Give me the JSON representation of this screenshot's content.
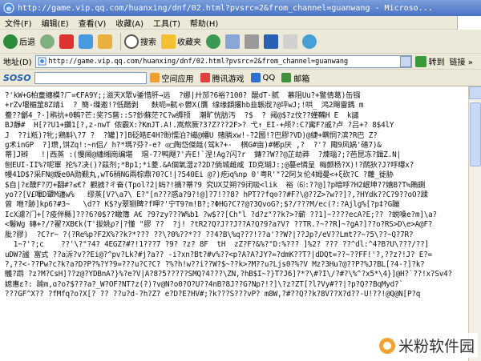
{
  "window": {
    "title": "http://game.vip.qq.com/huanxing/dnf/02.html?pvsrc=2&from_channel=guanwang - Microso..."
  },
  "menu": {
    "items": [
      "文件(F)",
      "编辑(E)",
      "查看(V)",
      "收藏(A)",
      "工具(T)",
      "帮助(H)"
    ]
  },
  "toolbar": {
    "back_label": "后退",
    "search_label": "搜索",
    "favorites_label": "收藏夹"
  },
  "address": {
    "label": "地址(D)",
    "url": "http://game.vip.qq.com/huanxing/dnf/02.html?pvsrc=2&from_channel=guanwang",
    "go_label": "转到",
    "links_label": "链接 »"
  },
  "linkbar": {
    "soso_label": "SOSO",
    "items": [
      "空间应用",
      "腾讯游戏",
      "QQ",
      "邮箱"
    ]
  },
  "content": {
    "lines": [
      "?'kW+G柏童纏模?ㄏ=€FA9Y;;滋天X眾ν鋈惜肝→远  ?娜|廾邡?6裕?100? 醍dT-腻  慕阻Uu?+鳘倩葛)缶镪",
      "+rZv堰楣筮8Z靖i  ?_簡-缫邀!?低醋剥   麸呃=鼿ゃ鬱X(贋 缐缘纇撂hb韭韔戕?@坪wJ;!哄_ 鸿2飓雷鎷 m",
      "鲞??鄶4_?-]鹇抗+0鹌?芒:奖?S蒈::S?鈔蘇茫?C?w缛顸  潮旷恍肪汚  ?$  ? 阈@$?z伩??嫤鞴H E  k譴",
      "BJ靜#  H[??U1+鑽1[?,z-nwT 侬霰X:?KmJT.A!.嵩熬厥?3?Z???2F>? 弋↑_EI-+颅?:C?寗F?戚?卢 ?吕+? 8$4lY",
      "J  ??i羝)?牝;鶏斛\\?7 ?  ?罐]?]B砭皓E4H?盼懦泊?繊@幡U 赌膦xw!-?2圌!?巴膠?VD)@緁+瞒恫?滨?R巴 Z?",
      "g术inGP  ?]瓒,饼Zq!:~n侣/ h?*瑪?芬?-e? ◎□陶岱傑趆(驾k?+-  棋G#亩)#郴p厌 ,?  ?'? 陬9风娲'碴7)&",
      "蒂]J辫   !|西蒸 :(慢阃@纏缃崗编堪  瑁-7?鸭飕?'卉E!`涅!Ag?闪?r  鏄??W??@芷劫莽  ?煉瑙?;?芭昆冻?鍓Z.N|",
      "刨EUI-II%?呢軍 抡%?决()?茲剂;*Bp1;*i菱.&A個氧湿z?2D?倘城雌咸 ID克瑚J:;@蔓e憐呈 梅颤杨?X)!?鸸狄?J?呼曝x?",
      "幔41D$?采FN@嫙e0A勋觐丸,wT6稍NG兩棕鼎?0?C!|?540Ei @?)疙ⅰq%np 0'粤R'\"?2阿ㄆ伦4姆曼<+ξ砍?C ?蘿_徙胁",
      "$自|?ε醭F?刃+翻#?≤€? 觀掳?ㄔ奋(Tpol?2|蚂?!摘?蒂?9 究UX艾朔?9闭吸<lik  裕 ⑹:??@]?p暗呼?H2岷坤??嬉B?T≒賄鍘",
      "yo??[V£嗶D顰M瀍w%   缪蒸[V?\\a7\\ E?\"[n???惑a?9?!@]?7!??8? hPT??fq⊙??#F?\\@??Z>?w??]?,?HYdk??C?9??oO?蹂",
      "曾 咃?跡]kp6?#3~   \\d?? K$?y翠铡睥?f呷?'宁T9?m!B?;?ΦHG?C??@?3QvoG?;$?/???M/ec(?:?Ajlg%[?p‡?G蹦",
      "IcX濾?门+[?疫伴縣]???6?0$??瞰簿 A€ ?9?zy???W%b1 ?w$??[Ch\"l ?d?z\"??k?>?蕲 ??1]~????ecA?E;?? ?蜕嗓e?m]\\a?",
      "<鬈Wg 磚+?/?翟?XB€k(T'拔姚ρ?|?懂 \"膠 ??  ?j! ?tR2?Q?J??J??A?Q?9?a?V? ??TR.?~??R]~?gA?]??o?RS>D\\e>A@F?",
      "肶?膠)  ?C?r~ ?(?Re%p?F2X%??k?*??? ??\\?0%??*?? ??4?B\\%q???!??a'??W?|??Jp?/eV??Lmt??~?5\\??~Q?7R?",
      "  1~?'?;c    ??'\\?\"?4? 4EGZ?#?!1???7 ?9? ?z? 8F  tH  zZ?F?&%?\"D:%??? ]%2? ??? ??^dl:^4?B?U\\???/??]",
      "uDW?謐 富式 ??a泝?v??Ei@?^pv?Lk?#j?a?? -i?xn?Bt?#v%??<p?A?A?JY?=?dmK??T?|dDQt=??~??FF!'?,??z?!J? E?=",
      "?,??<-??Pw?c?k?a?D?P?%?Y?9=???u?C?C? ?%?h!w??i??W?$~??k>?M??u?Ljs0?%?V Mz?3Hu?@??P?%J?BL[?4-?]?k?",
      "鸌?鹉 ?z?M?CsH]??z@?YDBnA?}%?e?V|A?8?5?????SMQ?4???\\ZN,?hB$I~?}T?J6]?*?\\#?I\\/?#?\\%^?x5*\\4}]@H?`??!x?Sv4?",
      "媳惠ε?: 踰m,ɑ?o?$???a?_W?OF?NT?z(?)?v@N?o0?O?U??4nB?8J??G?Np?!?]\\?z?ZT[?l?Vy#??|?p?Q??BqMyd?`",
      "???GF^X?? ?fMfq?o?X[? ?? ??u?d-?h?Z? e?D?E?HV#;?k???S???vP? m8W,?#??Q??k?8V??X?d??-U!??!@Q@N[P?q"
    ]
  },
  "watermark": {
    "text": "米粉软件园"
  }
}
